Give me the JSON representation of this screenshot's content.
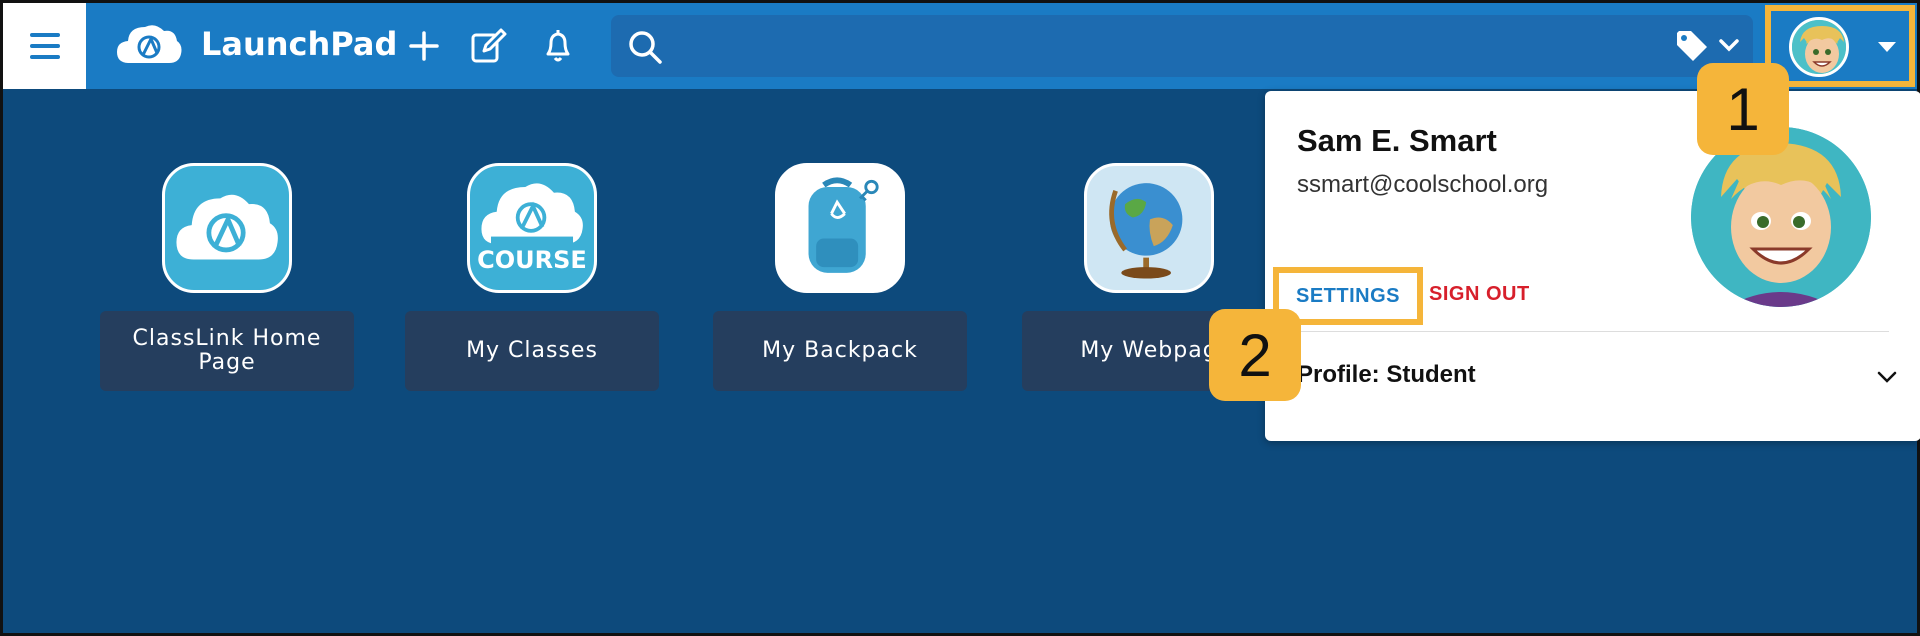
{
  "app": {
    "brand": "LaunchPad"
  },
  "search": {
    "placeholder": "",
    "value": ""
  },
  "apps": [
    {
      "label": "ClassLink Home Page",
      "icon": "classlink-cloud-icon"
    },
    {
      "label": "My Classes",
      "icon": "course-cloud-icon",
      "badge_text": "COURSE"
    },
    {
      "label": "My Backpack",
      "icon": "backpack-icon"
    },
    {
      "label": "My Webpag",
      "icon": "globe-icon"
    }
  ],
  "user_menu": {
    "name": "Sam E. Smart",
    "email": "ssmart@coolschool.org",
    "settings_label": "SETTINGS",
    "signout_label": "SIGN OUT",
    "profile_label": "Profile: Student"
  },
  "callouts": {
    "one": "1",
    "two": "2"
  },
  "colors": {
    "background": "#0d4a7c",
    "topbar": "#1a7bc4",
    "highlight": "#f5b53a",
    "signout": "#d71f2b"
  }
}
